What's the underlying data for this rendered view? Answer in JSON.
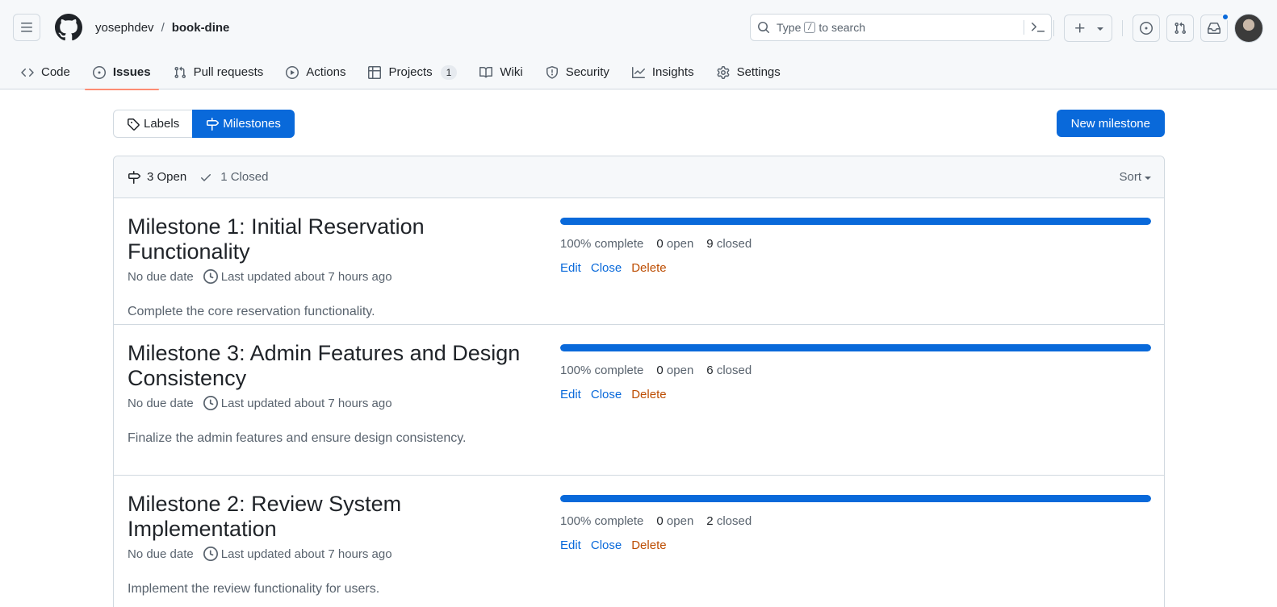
{
  "header": {
    "owner": "yosephdev",
    "separator": "/",
    "repo": "book-dine",
    "search": {
      "prefix": "Type",
      "key": "/",
      "suffix": "to search"
    }
  },
  "tabs": [
    {
      "label": "Code",
      "icon": "code-icon"
    },
    {
      "label": "Issues",
      "icon": "issue-opened-icon",
      "active": true
    },
    {
      "label": "Pull requests",
      "icon": "git-pull-request-icon"
    },
    {
      "label": "Actions",
      "icon": "play-icon"
    },
    {
      "label": "Projects",
      "icon": "table-icon",
      "counter": "1"
    },
    {
      "label": "Wiki",
      "icon": "book-icon"
    },
    {
      "label": "Security",
      "icon": "shield-icon"
    },
    {
      "label": "Insights",
      "icon": "graph-icon"
    },
    {
      "label": "Settings",
      "icon": "gear-icon"
    }
  ],
  "subnav": {
    "labels": "Labels",
    "milestones": "Milestones"
  },
  "new_milestone": "New milestone",
  "filter": {
    "open": "3 Open",
    "closed": "1 Closed",
    "sort": "Sort"
  },
  "milestones": [
    {
      "title": "Milestone 1: Initial Reservation Functionality",
      "due": "No due date",
      "updated": "Last updated about 7 hours ago",
      "description": "Complete the core reservation functionality.",
      "progress": 100,
      "complete": "100% complete",
      "open_count": "0",
      "open_label": "open",
      "closed_count": "9",
      "closed_label": "closed",
      "edit": "Edit",
      "close": "Close",
      "delete": "Delete"
    },
    {
      "title": "Milestone 3: Admin Features and Design Consistency",
      "due": "No due date",
      "updated": "Last updated about 7 hours ago",
      "description": "Finalize the admin features and ensure design consistency.",
      "progress": 100,
      "complete": "100% complete",
      "open_count": "0",
      "open_label": "open",
      "closed_count": "6",
      "closed_label": "closed",
      "edit": "Edit",
      "close": "Close",
      "delete": "Delete"
    },
    {
      "title": "Milestone 2: Review System Implementation",
      "due": "No due date",
      "updated": "Last updated about 7 hours ago",
      "description": "Implement the review functionality for users.",
      "progress": 100,
      "complete": "100% complete",
      "open_count": "0",
      "open_label": "open",
      "closed_count": "2",
      "closed_label": "closed",
      "edit": "Edit",
      "close": "Close",
      "delete": "Delete"
    }
  ],
  "colors": {
    "accent": "#0969da",
    "tab_underline": "#fd8c73",
    "danger": "#bc4c00",
    "notification": "#0969da"
  }
}
